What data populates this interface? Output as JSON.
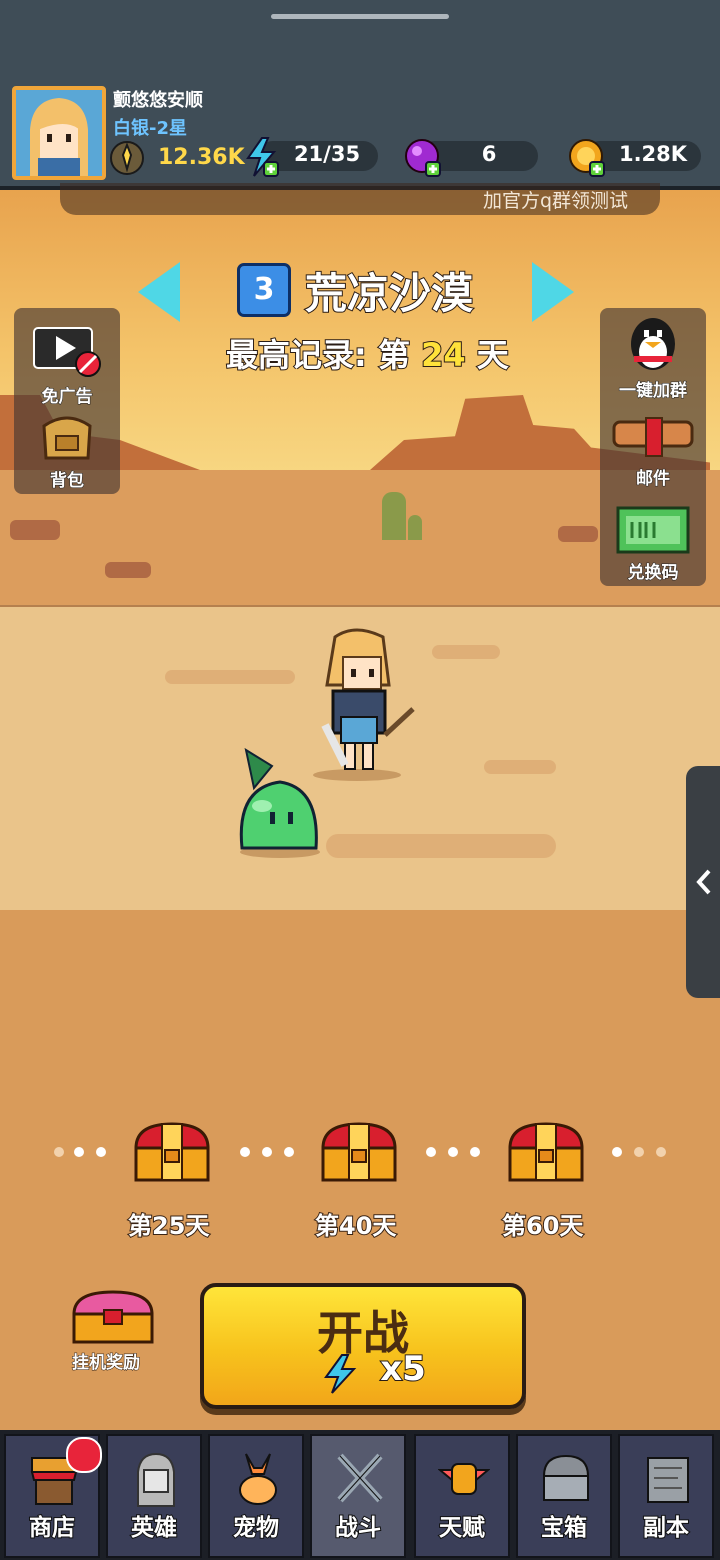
{
  "profile": {
    "nickname": "颤悠悠安顺",
    "rank": "白银-2星",
    "power": "12.36K"
  },
  "resources": {
    "energy": "21/35",
    "gems": "6",
    "gold": "1.28K"
  },
  "notice": "加官方q群领测试",
  "level": {
    "number": "3",
    "name": "荒凉沙漠",
    "record_prefix": "最高记录: 第",
    "record_days": "24",
    "record_suffix": "天"
  },
  "left_panel": {
    "no_ads": "免广告",
    "backpack": "背包"
  },
  "right_panel": {
    "join_group": "一键加群",
    "mail": "邮件",
    "redeem_code": "兑换码"
  },
  "chests": [
    {
      "label": "第25天"
    },
    {
      "label": "第40天"
    },
    {
      "label": "第60天"
    }
  ],
  "actions": {
    "idle_reward": "挂机奖励",
    "start": "开战",
    "start_cost": "x5"
  },
  "nav": [
    {
      "label": "商店",
      "icon": "shop-icon"
    },
    {
      "label": "英雄",
      "icon": "hero-icon"
    },
    {
      "label": "宠物",
      "icon": "pet-icon"
    },
    {
      "label": "战斗",
      "icon": "battle-icon"
    },
    {
      "label": "天赋",
      "icon": "talent-icon"
    },
    {
      "label": "宝箱",
      "icon": "chest-icon"
    },
    {
      "label": "副本",
      "icon": "dungeon-icon"
    }
  ],
  "colors": {
    "accent_yellow": "#ffe23a",
    "level_badge": "#3c8ee6",
    "arrow": "#4fd7e6",
    "notification_badge": "#e8243a"
  }
}
